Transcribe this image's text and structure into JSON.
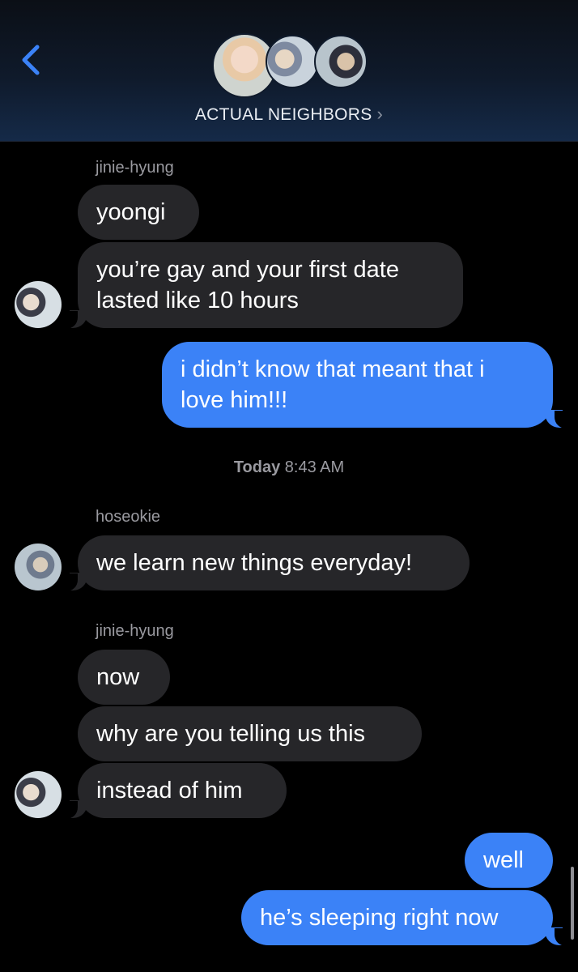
{
  "header": {
    "back_icon": "chevron-left-icon",
    "group_name": "ACTUAL NEIGHBORS",
    "group_chevron": "›",
    "accent": "#3b82f7"
  },
  "messages": [
    {
      "sender": "jinie-hyung"
    },
    {
      "text": "yoongi"
    },
    {
      "text_line1": "you’re gay and your first date",
      "text_line2": "lasted like 10 hours"
    },
    {
      "text_line1": "i didn’t know that meant that i",
      "text_line2": "love him!!!"
    },
    {
      "timestamp_day": "Today",
      "timestamp_time": "8:43 AM"
    },
    {
      "sender": "hoseokie"
    },
    {
      "text": "we learn new things everyday!"
    },
    {
      "sender": "jinie-hyung"
    },
    {
      "text": "now"
    },
    {
      "text": "why are you telling us this"
    },
    {
      "text": "instead of him"
    },
    {
      "text": "well"
    },
    {
      "text": "he’s sleeping right now"
    }
  ],
  "colors": {
    "incoming_bubble": "#262629",
    "outgoing_bubble": "#3b82f7",
    "background": "#000000"
  }
}
